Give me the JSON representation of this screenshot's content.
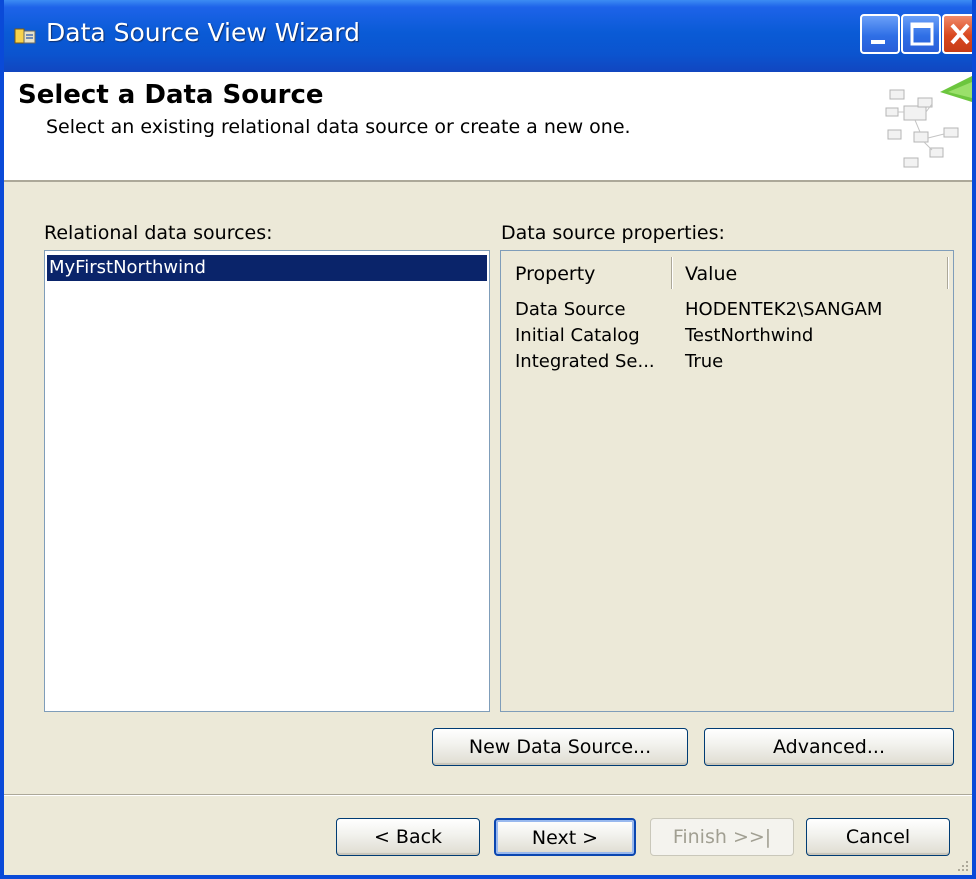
{
  "window": {
    "title": "Data Source View Wizard",
    "accent_color": "#0a4ad8",
    "caption_buttons": [
      "minimize-icon",
      "maximize-icon",
      "close-icon"
    ]
  },
  "header": {
    "title": "Select a Data Source",
    "subtitle": "Select an existing relational data source or create a new one.",
    "graphic": "wizard-diagram-icon"
  },
  "relational": {
    "label": "Relational data sources:",
    "items": [
      "MyFirstNorthwind"
    ],
    "selected": "MyFirstNorthwind"
  },
  "properties": {
    "label": "Data source properties:",
    "columns": [
      "Property",
      "Value"
    ],
    "rows": [
      {
        "property": "Data Source",
        "value": "HODENTEK2\\SANGAM"
      },
      {
        "property": "Initial Catalog",
        "value": "TestNorthwind"
      },
      {
        "property": "Integrated Se...",
        "value": "True"
      }
    ]
  },
  "actions": {
    "new_data_source": "New Data Source...",
    "advanced": "Advanced..."
  },
  "footer": {
    "back": "< Back",
    "next": "Next >",
    "finish": "Finish >>|",
    "cancel": "Cancel"
  }
}
